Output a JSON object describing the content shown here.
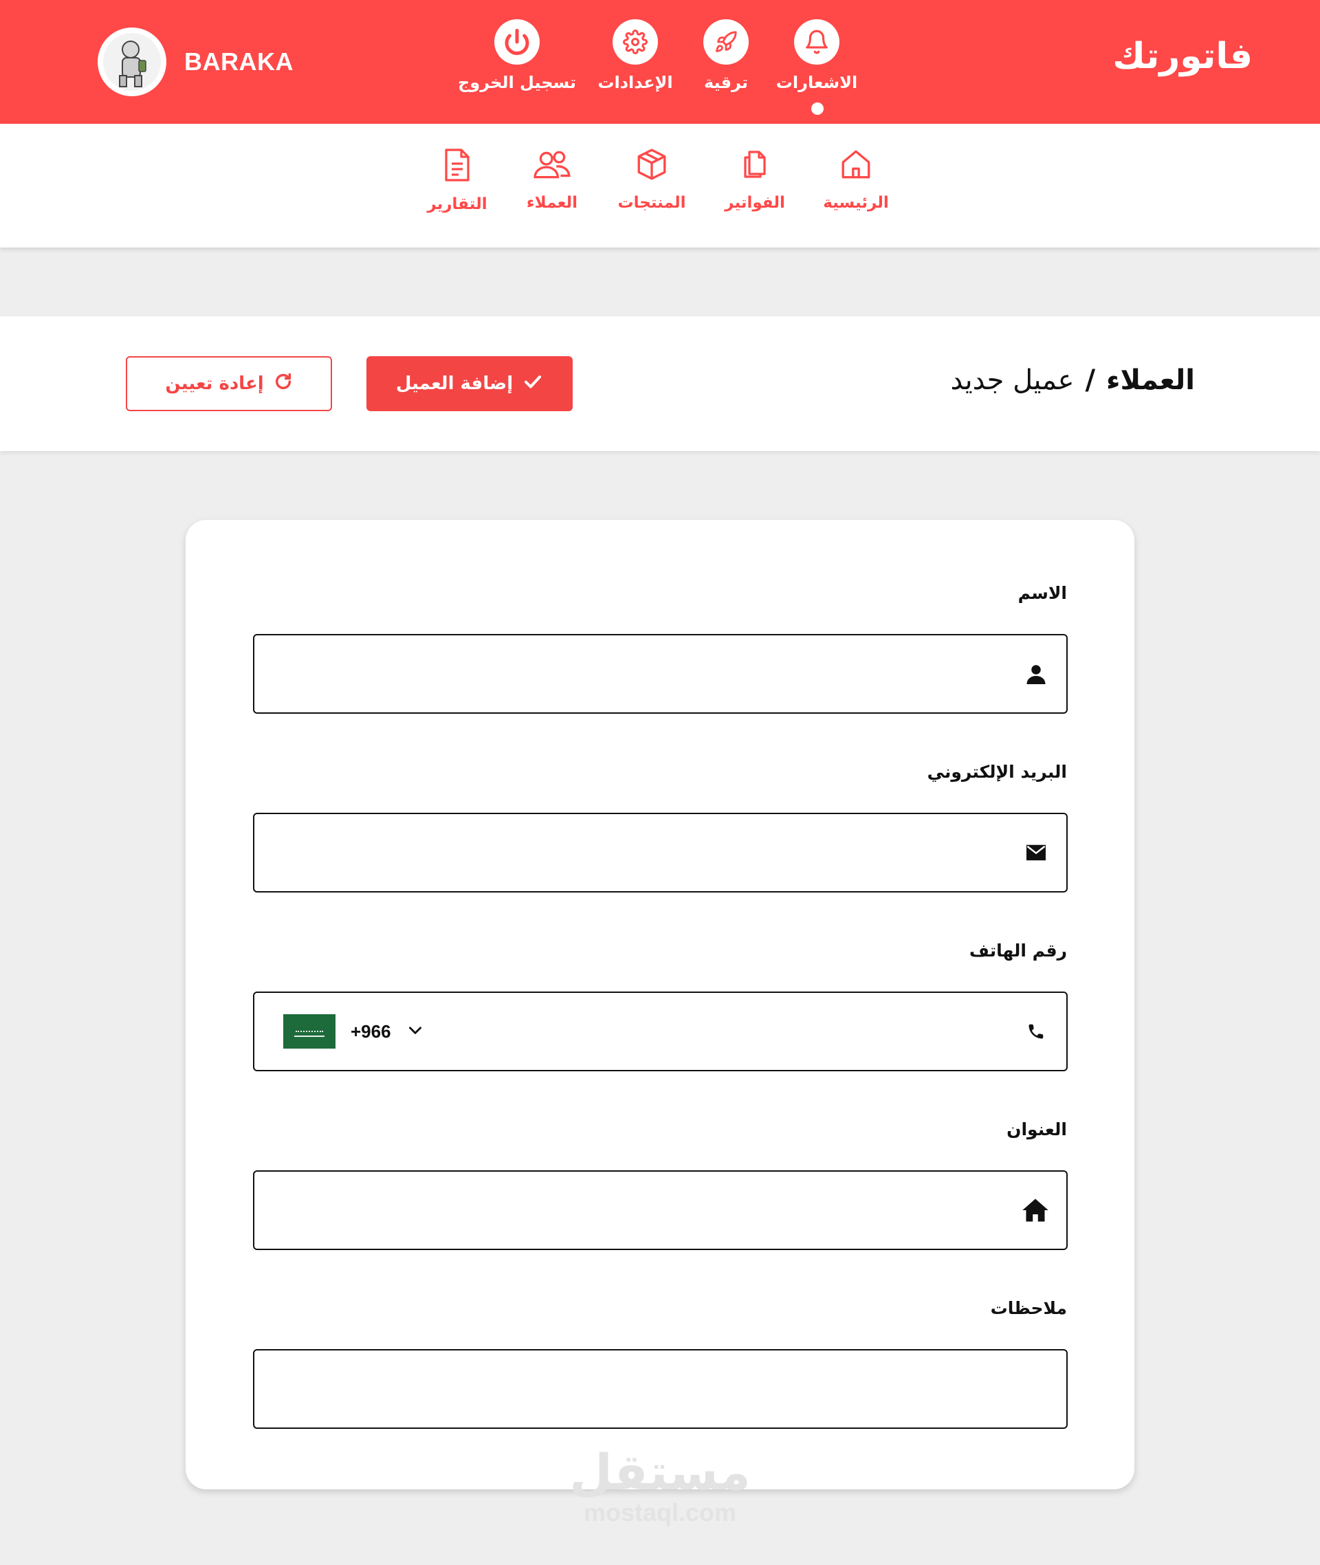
{
  "app": {
    "brand": "فاتورتك",
    "username": "BARAKA"
  },
  "top_actions": {
    "notifications": "الاشعارات",
    "upgrade": "ترقية",
    "settings": "الإعدادات",
    "logout": "تسجيل الخروج"
  },
  "nav": {
    "home": "الرئيسية",
    "invoices": "الفواتير",
    "products": "المنتجات",
    "customers": "العملاء",
    "reports": "التقارير",
    "active": "customers"
  },
  "breadcrumb": {
    "parent": "العملاء",
    "separator": "/",
    "current": "عميل جديد"
  },
  "buttons": {
    "add_customer": "إضافة العميل",
    "reset": "إعادة تعيين"
  },
  "form": {
    "name_label": "الاسم",
    "email_label": "البريد الإلكتروني",
    "phone_label": "رقم الهاتف",
    "address_label": "العنوان",
    "notes_label": "ملاحظات",
    "name_value": "",
    "email_value": "",
    "phone_value": "",
    "address_value": "",
    "notes_value": "",
    "dial_code": "+966"
  },
  "icons": {
    "notifications": "bell-icon",
    "upgrade": "rocket-icon",
    "settings": "gear-icon",
    "logout": "power-icon",
    "home": "house-icon",
    "invoices": "documents-icon",
    "products": "box-icon",
    "customers": "users-icon",
    "reports": "report-icon"
  },
  "watermark": {
    "arabic": "مستقل",
    "latin": "mostaql.com"
  },
  "colors": {
    "accent": "#ff4848",
    "button": "#f44545",
    "background": "#eeeeee"
  }
}
